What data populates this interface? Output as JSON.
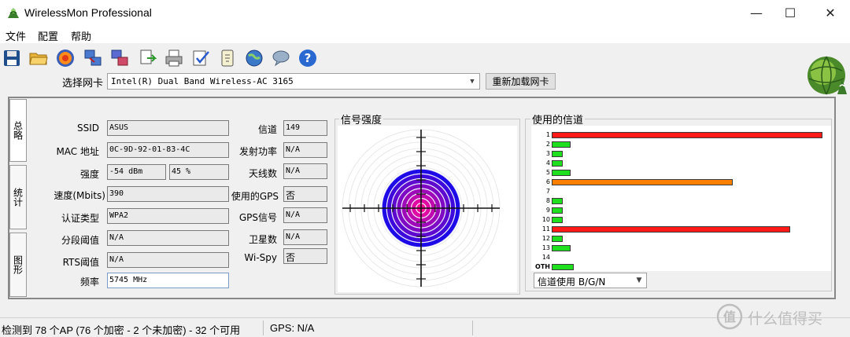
{
  "window": {
    "title": "WirelessMon Professional",
    "minimize": "—",
    "maximize": "☐",
    "close": "✕"
  },
  "menu": [
    "文件",
    "配置",
    "帮助"
  ],
  "toolbar_icons": [
    "save-icon",
    "open-folder-icon",
    "record-icon",
    "network-icon",
    "map-icon",
    "export-icon",
    "print-icon",
    "check-icon",
    "device-icon",
    "globe-icon",
    "chat-icon",
    "help-icon"
  ],
  "nic": {
    "label": "选择网卡",
    "value": "Intel(R) Dual Band Wireless-AC 3165",
    "reload": "重新加载网卡"
  },
  "tabs": [
    "总略",
    "统计",
    "图形"
  ],
  "info": {
    "ssid_label": "SSID",
    "ssid": "ASUS",
    "mac_label": "MAC 地址",
    "mac": "0C-9D-92-01-83-4C",
    "strength_label": "强度",
    "strength_dbm": "-54 dBm",
    "strength_pct": "45 %",
    "speed_label": "速度(Mbits)",
    "speed": "390",
    "auth_label": "认证类型",
    "auth": "WPA2",
    "frag_label": "分段阈值",
    "frag": "N/A",
    "rts_label": "RTS阈值",
    "rts": "N/A",
    "freq_label": "频率",
    "freq": "5745 MHz",
    "channel_label": "信道",
    "channel": "149",
    "txpower_label": "发射功率",
    "txpower": "N/A",
    "antenna_label": "天线数",
    "antenna": "N/A",
    "gps_used_label": "使用的GPS",
    "gps_used": "否",
    "gps_signal_label": "GPS信号",
    "gps_signal": "N/A",
    "sat_label": "卫星数",
    "sat": "N/A",
    "wispy_label": "Wi-Spy",
    "wispy": "否"
  },
  "signal": {
    "title": "信号强度",
    "level_pct": 45
  },
  "channels": {
    "title": "使用的信道",
    "rows": [
      {
        "label": "1",
        "value": 100,
        "color": "#ff1a1a"
      },
      {
        "label": "2",
        "value": 7,
        "color": "#1ee01e"
      },
      {
        "label": "3",
        "value": 4,
        "color": "#1ee01e"
      },
      {
        "label": "4",
        "value": 4,
        "color": "#1ee01e"
      },
      {
        "label": "5",
        "value": 7,
        "color": "#1ee01e"
      },
      {
        "label": "6",
        "value": 67,
        "color": "#ff8000"
      },
      {
        "label": "7",
        "value": 0,
        "color": "#1ee01e"
      },
      {
        "label": "8",
        "value": 4,
        "color": "#1ee01e"
      },
      {
        "label": "9",
        "value": 4,
        "color": "#1ee01e"
      },
      {
        "label": "10",
        "value": 4,
        "color": "#1ee01e"
      },
      {
        "label": "11",
        "value": 88,
        "color": "#ff1a1a"
      },
      {
        "label": "12",
        "value": 4,
        "color": "#1ee01e"
      },
      {
        "label": "13",
        "value": 7,
        "color": "#1ee01e"
      },
      {
        "label": "14",
        "value": 0,
        "color": "#1ee01e"
      },
      {
        "label": "OTH",
        "value": 8,
        "color": "#1ee01e"
      }
    ],
    "mode": "信道使用 B/G/N"
  },
  "status": {
    "ap_summary": "检测到 78 个AP (76 个加密 - 2 个未加密) - 32 个可用",
    "gps": "GPS: N/A"
  },
  "watermark": "什么值得买"
}
